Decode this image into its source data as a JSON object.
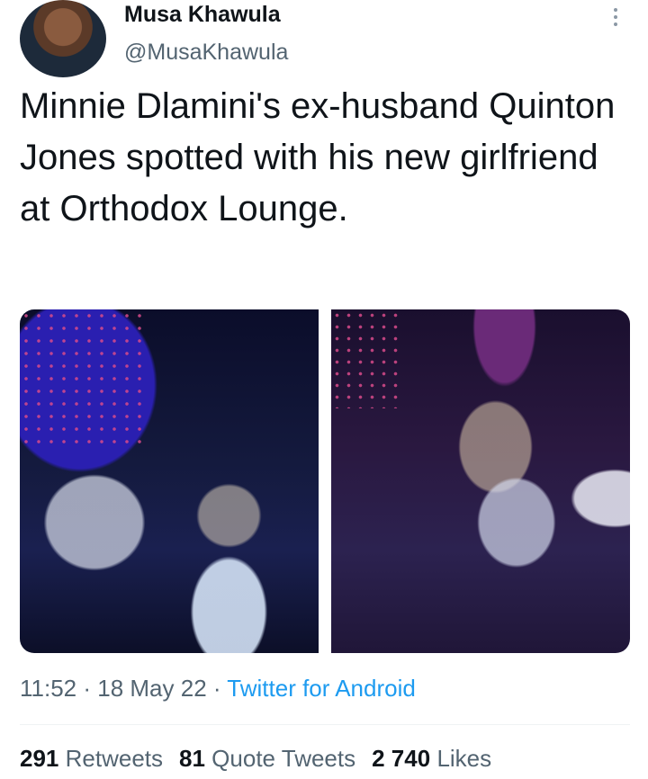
{
  "tweet": {
    "author_name": "Musa Khawula",
    "author_handle": "@MusaKhawula",
    "text": "Minnie Dlamini's ex-husband Quinton Jones spotted with his new girlfriend at Orthodox Lounge.",
    "time": "11:52",
    "separator": " · ",
    "date": "18 May 22",
    "source": "Twitter for Android"
  },
  "stats": {
    "retweets_count": "291",
    "retweets_label": "Retweets",
    "quote_count": "81",
    "quote_label": "Quote Tweets",
    "likes_count": "2 740",
    "likes_label": "Likes"
  },
  "colors": {
    "text_primary": "#0f1419",
    "text_secondary": "#536471",
    "link": "#1d9bf0",
    "divider": "#eff3f4"
  },
  "icons": {
    "more": "more-vertical-icon"
  }
}
